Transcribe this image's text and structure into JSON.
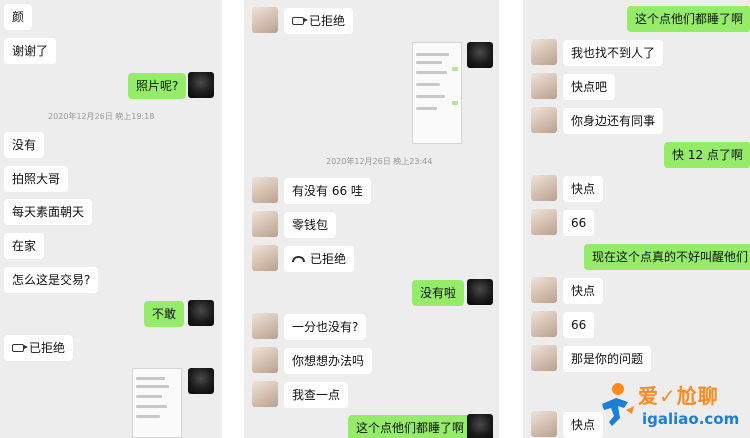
{
  "panel1": {
    "messages": [
      "颜",
      "谢谢了",
      "照片呢?",
      "没有",
      "拍照大哥",
      "每天素面朝天",
      "在家",
      "怎么这是交易?",
      "不敢",
      "已拒绝"
    ],
    "timestamp": "2020年12月26日 晚上19:18"
  },
  "panel2": {
    "messages": [
      "已拒绝",
      "有没有 66 哇",
      "零钱包",
      "已拒绝",
      "没有啦",
      "一分也没有?",
      "你想想办法吗",
      "我查一点",
      "这个点他们都睡了啊"
    ],
    "timestamp": "2020年12月26日 晚上23:44"
  },
  "panel3": {
    "messages": [
      "这个点他们都睡了啊",
      "我也找不到人了",
      "快点吧",
      "你身边还有同事",
      "快 12 点了啊",
      "快点",
      "66",
      "现在这个点真的不好叫醒他们",
      "快点",
      "66",
      "那是你的问题",
      "快点"
    ]
  },
  "watermark": {
    "title": "爱✓尬聊",
    "url": "igaliao.com"
  },
  "icons": [
    "video-call-icon",
    "phone-hangup-icon",
    "avatar"
  ],
  "colors": {
    "panel_bg": "#ededed",
    "incoming_bubble": "#ffffff",
    "outgoing_bubble": "#95ec69",
    "timestamp": "#999999",
    "watermark_orange": "#ff8a1f",
    "watermark_blue": "#1a7fd6"
  }
}
